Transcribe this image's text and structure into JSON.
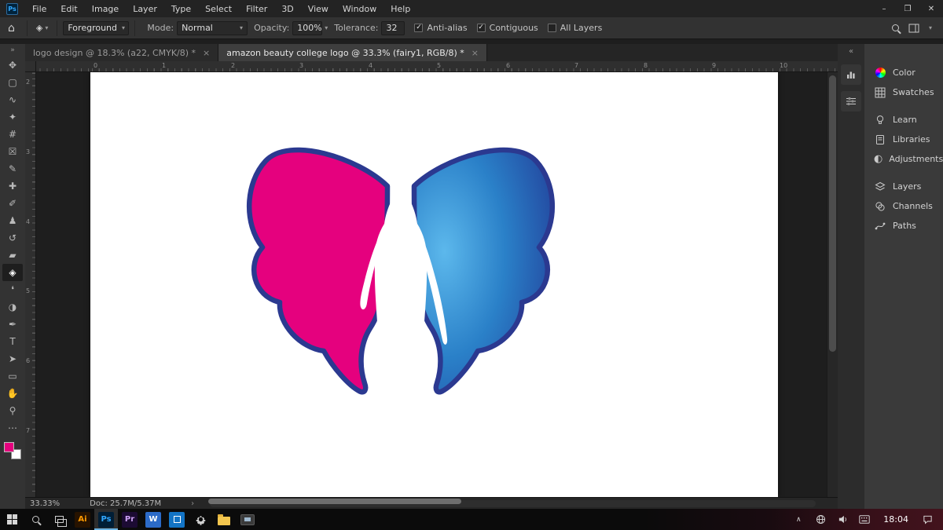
{
  "app": {
    "badge": "Ps"
  },
  "menu": {
    "items": [
      "File",
      "Edit",
      "Image",
      "Layer",
      "Type",
      "Select",
      "Filter",
      "3D",
      "View",
      "Window",
      "Help"
    ]
  },
  "window_controls": {
    "minimize": "–",
    "restore": "❐",
    "close": "✕"
  },
  "options_bar": {
    "home_icon": "⌂",
    "tool_icon": "◈",
    "caret": "▾",
    "fill_source": "Foreground",
    "mode_label": "Mode:",
    "mode_value": "Normal",
    "opacity_label": "Opacity:",
    "opacity_value": "100%",
    "tolerance_label": "Tolerance:",
    "tolerance_value": "32",
    "checkboxes": [
      {
        "label": "Anti-alias",
        "mark": "✓",
        "checked": true
      },
      {
        "label": "Contiguous",
        "mark": "✓",
        "checked": true
      },
      {
        "label": "All Layers",
        "mark": "",
        "checked": false
      }
    ]
  },
  "tabs": [
    {
      "title": "logo design @ 18.3% (a22, CMYK/8) *",
      "close": "×",
      "active": false
    },
    {
      "title": "amazon beauty college logo @ 33.3% (fairy1, RGB/8) *",
      "close": "×",
      "active": true
    }
  ],
  "toolbar": {
    "expand": "»",
    "tools": [
      {
        "name": "move-tool",
        "glyph": "✥"
      },
      {
        "name": "marquee-tool",
        "glyph": "▢"
      },
      {
        "name": "lasso-tool",
        "glyph": "∿"
      },
      {
        "name": "quick-selection-tool",
        "glyph": "✦"
      },
      {
        "name": "crop-tool",
        "glyph": "#"
      },
      {
        "name": "frame-tool",
        "glyph": "☒"
      },
      {
        "name": "eyedropper-tool",
        "glyph": "✎"
      },
      {
        "name": "healing-brush-tool",
        "glyph": "✚"
      },
      {
        "name": "brush-tool",
        "glyph": "✐"
      },
      {
        "name": "clone-stamp-tool",
        "glyph": "♟"
      },
      {
        "name": "history-brush-tool",
        "glyph": "↺"
      },
      {
        "name": "eraser-tool",
        "glyph": "▰"
      },
      {
        "name": "paint-bucket-tool",
        "glyph": "◈",
        "selected": true
      },
      {
        "name": "blur-tool",
        "glyph": "❛"
      },
      {
        "name": "dodge-tool",
        "glyph": "◑"
      },
      {
        "name": "pen-tool",
        "glyph": "✒"
      },
      {
        "name": "type-tool",
        "glyph": "T"
      },
      {
        "name": "path-selection-tool",
        "glyph": "➤"
      },
      {
        "name": "rectangle-tool",
        "glyph": "▭"
      },
      {
        "name": "hand-tool",
        "glyph": "✋"
      },
      {
        "name": "zoom-tool",
        "glyph": "⚲"
      },
      {
        "name": "edit-toolbar",
        "glyph": "⋯"
      }
    ],
    "foreground_color": "#e5017e",
    "background_color": "#ffffff"
  },
  "rulers": {
    "h": [
      "0",
      "1",
      "2",
      "3",
      "4",
      "5",
      "6",
      "7",
      "8",
      "9",
      "10"
    ],
    "v": [
      "2",
      "3",
      "4",
      "5",
      "6",
      "7"
    ]
  },
  "logo": {
    "outline_color": "#2b3990",
    "left_wing_color": "#e5017e",
    "right_wing_gradient": [
      "#5cb8ec",
      "#2a80c8",
      "#23479f"
    ],
    "figure_color": "#ffffff"
  },
  "status_bar": {
    "zoom": "33.33%",
    "doc_size": "Doc: 25.7M/5.37M",
    "chevron": "›"
  },
  "right_rail": {
    "collapse": "«"
  },
  "right_panel": {
    "groups": [
      {
        "items": [
          {
            "label": "Color"
          },
          {
            "label": "Swatches"
          }
        ]
      },
      {
        "items": [
          {
            "label": "Learn"
          },
          {
            "label": "Libraries"
          },
          {
            "label": "Adjustments"
          }
        ]
      },
      {
        "items": [
          {
            "label": "Layers"
          },
          {
            "label": "Channels"
          },
          {
            "label": "Paths"
          }
        ]
      }
    ]
  },
  "taskbar": {
    "apps": [
      {
        "name": "illustrator",
        "label": "Ai"
      },
      {
        "name": "photoshop",
        "label": "Ps"
      },
      {
        "name": "premiere",
        "label": "Pr"
      },
      {
        "name": "word",
        "label": "W"
      }
    ],
    "time": "18:04",
    "tray_chevron": "∧"
  }
}
